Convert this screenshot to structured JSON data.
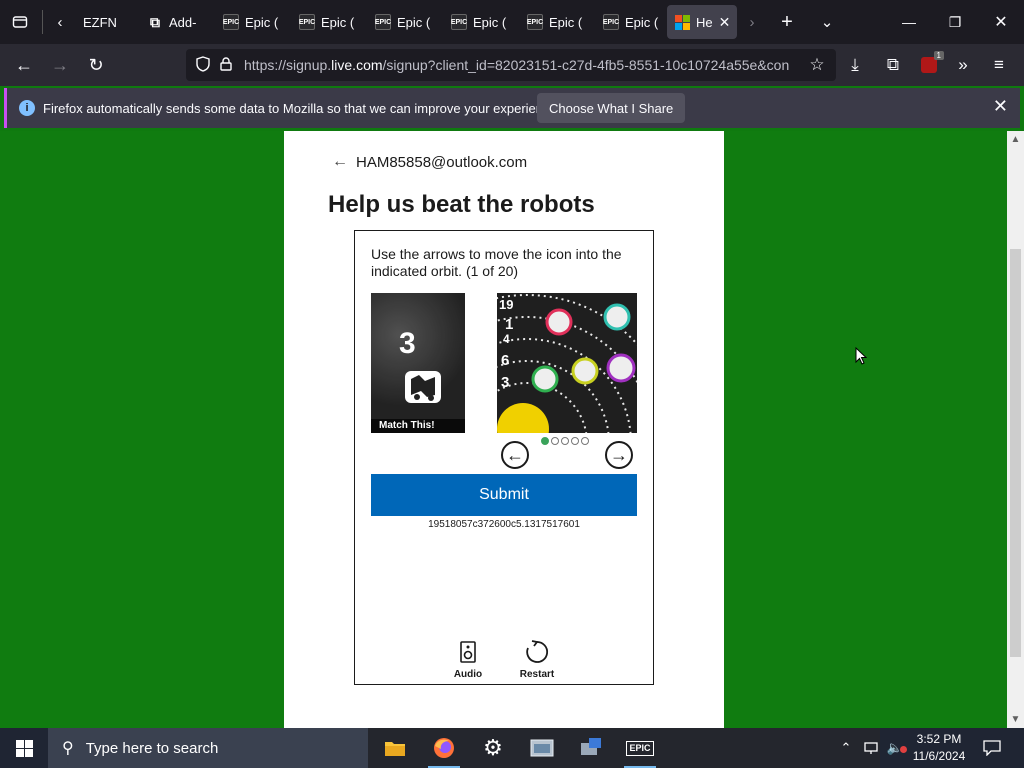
{
  "browser": {
    "tabs": [
      {
        "label": "EZFN",
        "icon": "ezfn"
      },
      {
        "label": "Add-",
        "icon": "puzzle-icon"
      },
      {
        "label": "Epic (",
        "icon": "epic-games-icon"
      },
      {
        "label": "Epic (",
        "icon": "epic-games-icon"
      },
      {
        "label": "Epic (",
        "icon": "epic-games-icon"
      },
      {
        "label": "Epic (",
        "icon": "epic-games-icon"
      },
      {
        "label": "Epic (",
        "icon": "epic-games-icon"
      },
      {
        "label": "Epic (",
        "icon": "epic-games-icon"
      },
      {
        "label": "He",
        "icon": "microsoft-logo-icon",
        "active": true
      }
    ],
    "url_prefix": "https://signup.",
    "url_host": "live.com",
    "url_rest": "/signup?client_id=82023151-c27d-4fb5-8551-10c10724a55e&con",
    "extension_badge": "1"
  },
  "notification": {
    "message": "Firefox automatically sends some data to Mozilla so that we can improve your experience.",
    "button": "Choose What I Share"
  },
  "signup": {
    "email": "HAM85858@outlook.com",
    "title": "Help us beat the robots"
  },
  "captcha": {
    "instructions": "Use the arrows to move the icon into the indicated orbit. (1 of 20)",
    "match_number": "3",
    "match_caption": "Match This!",
    "orbit_numbers": [
      "19",
      "1",
      "4",
      "6",
      "3"
    ],
    "page_dots": 5,
    "active_dot": 0,
    "submit_label": "Submit",
    "token": "19518057c372600c5.1317517601",
    "audio_label": "Audio",
    "restart_label": "Restart"
  },
  "taskbar": {
    "search_placeholder": "Type here to search",
    "time": "3:52 PM",
    "date": "11/6/2024"
  },
  "colors": {
    "page_green": "#107c10",
    "submit_blue": "#0067b8",
    "tab_bg": "#1c1b22",
    "nav_bg": "#2b2a33"
  }
}
